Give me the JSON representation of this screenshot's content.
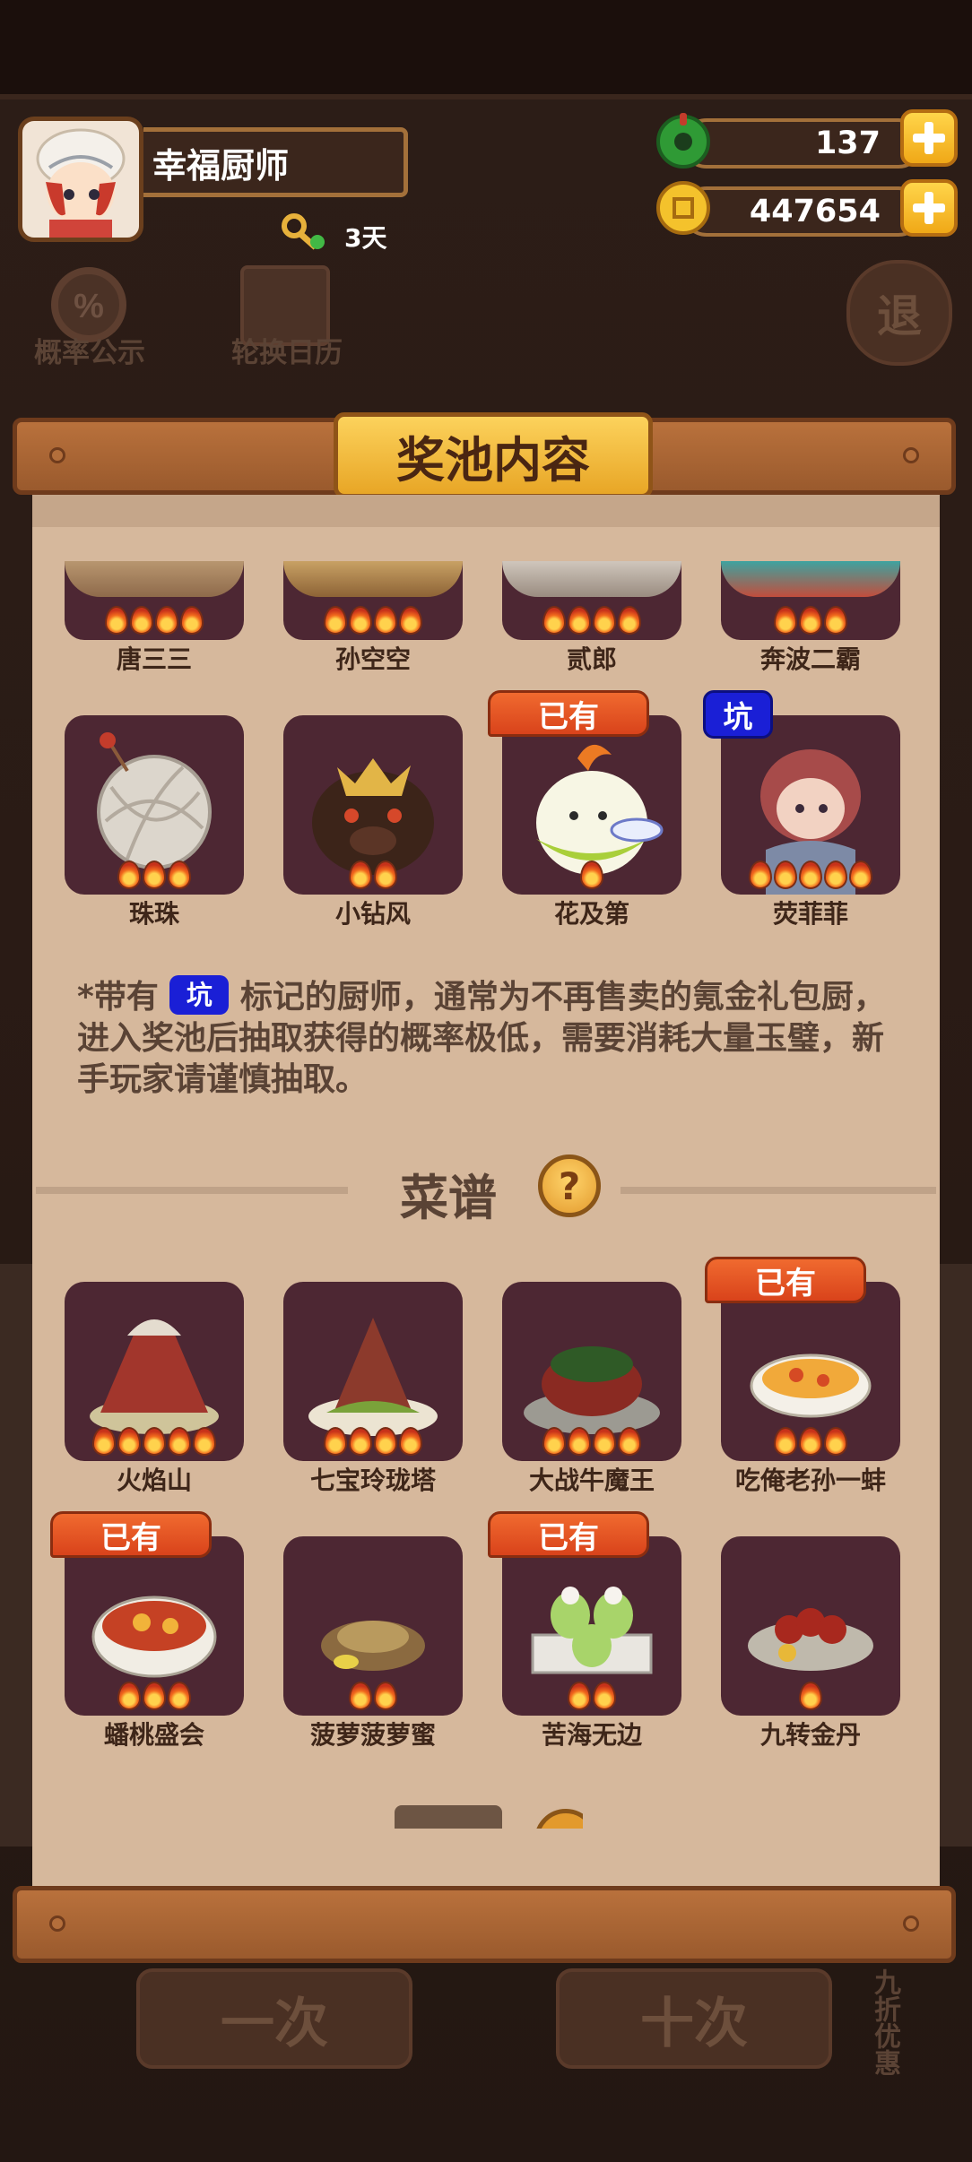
{
  "player": {
    "name": "幸福厨师",
    "days": "3天"
  },
  "resources": {
    "jade": "137",
    "coins": "447654"
  },
  "background": {
    "probability_label": "概率公示",
    "calendar_label": "轮换日历",
    "exit_label": "退",
    "once_label": "一次",
    "tenx_label": "十次",
    "discount_label": "九折优惠"
  },
  "modal": {
    "title": "奖池内容",
    "chefs_row1": [
      "唐三三",
      "孙空空",
      "贰郎",
      "奔波二霸"
    ],
    "chefs_row1_flames": [
      4,
      4,
      4,
      3
    ],
    "chefs_row2": [
      {
        "name": "珠珠",
        "flames": 3,
        "tag": ""
      },
      {
        "name": "小钻风",
        "flames": 2,
        "tag": ""
      },
      {
        "name": "花及第",
        "flames": 1,
        "tag": "已有"
      },
      {
        "name": "荧菲菲",
        "flames": 5,
        "tag": "坑"
      }
    ],
    "note_prefix": "*带有",
    "note_pit": "坑",
    "note_text": "标记的厨师，通常为不再售卖的氪金礼包厨，进入奖池后抽取获得的概率极低，需要消耗大量玉璧，新手玩家请谨慎抽取。",
    "recipes_title": "菜谱",
    "help_icon": "?",
    "recipes_row1": [
      {
        "name": "火焰山",
        "flames": 5,
        "tag": ""
      },
      {
        "name": "七宝玲珑塔",
        "flames": 4,
        "tag": ""
      },
      {
        "name": "大战牛魔王",
        "flames": 4,
        "tag": ""
      },
      {
        "name": "吃俺老孙一蚌",
        "flames": 3,
        "tag": "已有"
      }
    ],
    "recipes_row2": [
      {
        "name": "蟠桃盛会",
        "flames": 3,
        "tag": "已有"
      },
      {
        "name": "菠萝菠萝蜜",
        "flames": 2,
        "tag": ""
      },
      {
        "name": "苦海无边",
        "flames": 2,
        "tag": "已有"
      },
      {
        "name": "九转金丹",
        "flames": 1,
        "tag": ""
      }
    ]
  },
  "colors": {
    "modal_bg": "#d6b89c",
    "have_tag": "#e4521f",
    "pit_tag": "#1a1fd6",
    "card_bg": "#4d2733"
  }
}
